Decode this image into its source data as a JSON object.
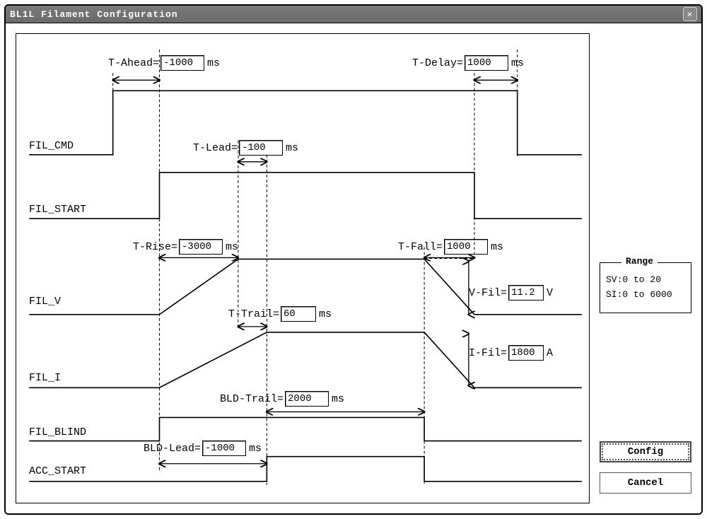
{
  "window": {
    "title": "BL1L Filament Configuration"
  },
  "rows": {
    "fil_cmd": "FIL_CMD",
    "fil_start": "FIL_START",
    "fil_v": "FIL_V",
    "fil_i": "FIL_I",
    "fil_blind": "FIL_BLIND",
    "acc_start": "ACC_START"
  },
  "fields": {
    "t_ahead": {
      "label": "T-Ahead=",
      "value": "-1000",
      "unit": "ms"
    },
    "t_delay": {
      "label": "T-Delay=",
      "value": "1000",
      "unit": "ms"
    },
    "t_lead": {
      "label": "T-Lead=",
      "value": "-100",
      "unit": "ms"
    },
    "t_rise": {
      "label": "T-Rise=",
      "value": "-3000",
      "unit": "ms"
    },
    "t_fall": {
      "label": "T-Fall=",
      "value": "1000",
      "unit": "ms"
    },
    "t_trail": {
      "label": "T-Trail=",
      "value": "60",
      "unit": "ms"
    },
    "v_fil": {
      "label": "V-Fil=",
      "value": "11.2",
      "unit": "V"
    },
    "i_fil": {
      "label": "I-Fil=",
      "value": "1800",
      "unit": "A"
    },
    "bld_trail": {
      "label": "BLD-Trail=",
      "value": "2000",
      "unit": "ms"
    },
    "bld_lead": {
      "label": "BLD-Lead=",
      "value": "-1000",
      "unit": "ms"
    }
  },
  "range": {
    "legend": "Range",
    "sv": "SV:0 to 20",
    "si": "SI:0 to 6000"
  },
  "buttons": {
    "config": "Config",
    "cancel": "Cancel"
  }
}
